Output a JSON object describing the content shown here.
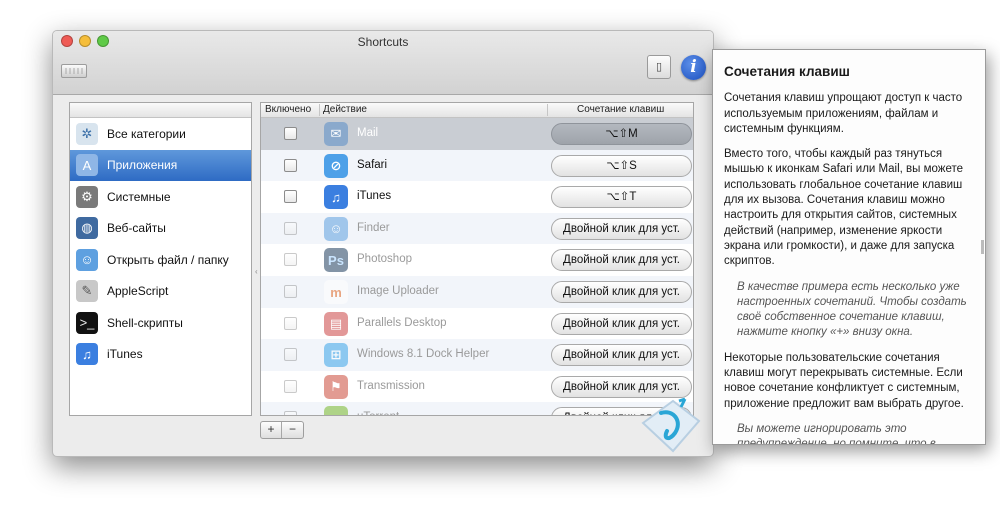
{
  "window": {
    "title": "Shortcuts"
  },
  "sidebar": {
    "items": [
      {
        "label": "Все категории",
        "icon": "all-categories-icon",
        "selected": false
      },
      {
        "label": "Приложения",
        "icon": "applications-icon",
        "selected": true
      },
      {
        "label": "Системные",
        "icon": "system-icon",
        "selected": false
      },
      {
        "label": "Веб-сайты",
        "icon": "websites-icon",
        "selected": false
      },
      {
        "label": "Открыть файл / папку",
        "icon": "finder-open-icon",
        "selected": false
      },
      {
        "label": "AppleScript",
        "icon": "applescript-icon",
        "selected": false
      },
      {
        "label": "Shell-скрипты",
        "icon": "terminal-icon",
        "selected": false
      },
      {
        "label": "iTunes",
        "icon": "itunes-icon",
        "selected": false
      }
    ]
  },
  "table": {
    "headers": {
      "enabled": "Включено",
      "action": "Действие",
      "shortcut": "Сочетание клавиш"
    },
    "rows": [
      {
        "name": "Mail",
        "shortcut": "⌥⇧M",
        "state": "selected",
        "icon": "mail-icon"
      },
      {
        "name": "Safari",
        "shortcut": "⌥⇧S",
        "state": "normal",
        "icon": "safari-icon"
      },
      {
        "name": "iTunes",
        "shortcut": "⌥⇧T",
        "state": "normal",
        "icon": "itunes-icon"
      },
      {
        "name": "Finder",
        "shortcut": "Двойной клик для уст.",
        "state": "dim",
        "icon": "finder-icon"
      },
      {
        "name": "Photoshop",
        "shortcut": "Двойной клик для уст.",
        "state": "dim",
        "icon": "photoshop-icon"
      },
      {
        "name": "Image Uploader",
        "shortcut": "Двойной клик для уст.",
        "state": "dim",
        "icon": "image-uploader-icon"
      },
      {
        "name": "Parallels Desktop",
        "shortcut": "Двойной клик для уст.",
        "state": "dim",
        "icon": "parallels-icon"
      },
      {
        "name": "Windows 8.1 Dock Helper",
        "shortcut": "Двойной клик для уст.",
        "state": "dim",
        "icon": "windows-icon"
      },
      {
        "name": "Transmission",
        "shortcut": "Двойной клик для уст.",
        "state": "dim",
        "icon": "transmission-icon"
      },
      {
        "name": "uTorrent",
        "shortcut": "Двойной клик для уст.",
        "state": "dim",
        "icon": "utorrent-icon"
      }
    ]
  },
  "controls": {
    "add_label": "+",
    "remove_label": "−"
  },
  "help": {
    "title": "Сочетания клавиш",
    "paragraphs": [
      {
        "text": "Сочетания клавиш упрощают доступ к часто используемым приложениям, файлам и системным функциям.",
        "italic": false
      },
      {
        "text": "Вместо того, чтобы каждый раз тянуться мышью к иконкам Safari или Mail, вы можете использовать глобальное сочетание клавиш для их вызова. Сочетания клавиш можно настроить для открытия сайтов, системных действий (например, изменение яркости экрана или громкости), и даже для запуска скриптов.",
        "italic": false
      },
      {
        "text": "В качестве примера есть несколько уже настроенных сочетаний. Чтобы создать своё собственное сочетание клавиш, нажмите кнопку «+» внизу окна.",
        "italic": true
      },
      {
        "text": "Некоторые пользовательские сочетания клавиш могут перекрывать системные. Если новое сочетание конфликтует с системным, приложение предложит вам выбрать другое.",
        "italic": false
      },
      {
        "text": "Вы можете игнорировать это предупреждение, но помните, что в таком случае системное сочетание клавиш не",
        "italic": true
      }
    ]
  },
  "colors": {
    "selection": "#3a78d0",
    "accent": "#1b4fc0"
  }
}
